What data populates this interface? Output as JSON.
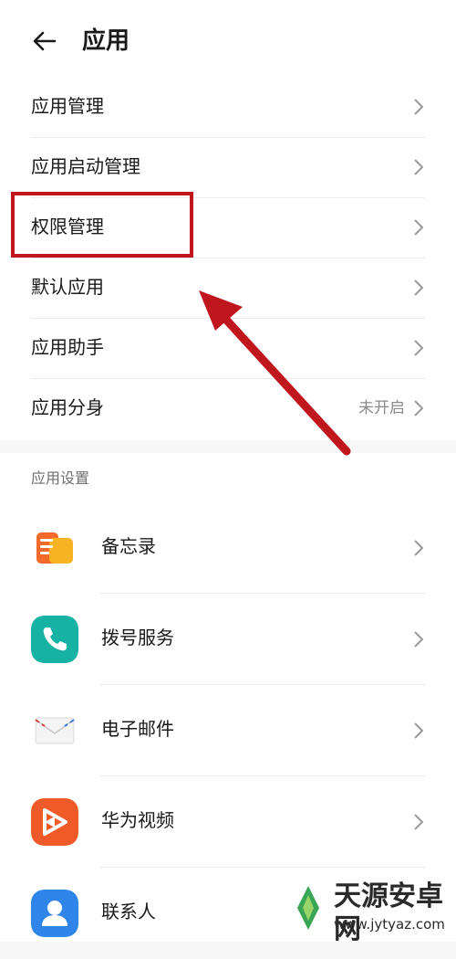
{
  "header": {
    "title": "应用"
  },
  "menu": {
    "items": [
      {
        "label": "应用管理",
        "value": ""
      },
      {
        "label": "应用启动管理",
        "value": ""
      },
      {
        "label": "权限管理",
        "value": ""
      },
      {
        "label": "默认应用",
        "value": ""
      },
      {
        "label": "应用助手",
        "value": ""
      },
      {
        "label": "应用分身",
        "value": "未开启"
      }
    ]
  },
  "app_settings": {
    "title": "应用设置",
    "apps": [
      {
        "label": "备忘录",
        "icon": "memo-icon"
      },
      {
        "label": "拨号服务",
        "icon": "phone-icon"
      },
      {
        "label": "电子邮件",
        "icon": "mail-icon"
      },
      {
        "label": "华为视频",
        "icon": "video-icon"
      },
      {
        "label": "联系人",
        "icon": "contacts-icon"
      }
    ]
  },
  "annotation": {
    "color": "#c0161d"
  },
  "watermark": {
    "line1": "天源安卓网",
    "line2": "www.jytyaz.com"
  }
}
